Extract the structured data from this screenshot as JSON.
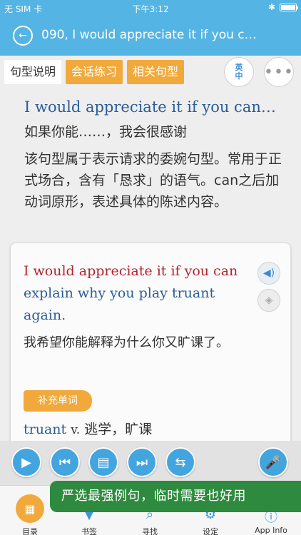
{
  "status": {
    "carrier": "无 SIM 卡",
    "time": "下午3:12"
  },
  "nav": {
    "title": "090, I would appreciate it if you c…"
  },
  "tabs": [
    {
      "label": "句型说明"
    },
    {
      "label": "会话练习"
    },
    {
      "label": "相关句型"
    }
  ],
  "lang_toggle": {
    "top": "英",
    "bottom": "中"
  },
  "pattern": {
    "english": "I would appreciate it if you can…",
    "chinese": "如果你能……，我会很感谢",
    "description": "该句型属于表示请求的委婉句型。常用于正式场合，含有「恳求」的语气。can之后加动词原形，表述具体的陈述内容。"
  },
  "example": {
    "highlight": "I would appreciate it if you can",
    "rest": "explain why you play truant again.",
    "chinese": "我希望你能解释为什么你又旷课了。"
  },
  "vocab": {
    "badge": "补充单词",
    "word": "truant",
    "pos": "v.",
    "meaning": "逃学，旷课"
  },
  "banner": {
    "text": "严选最强例句，临时需要也好用"
  },
  "tabbar": [
    {
      "label": "目录"
    },
    {
      "label": "书签"
    },
    {
      "label": "寻找"
    },
    {
      "label": "设定"
    },
    {
      "label": "App Info"
    }
  ],
  "colors": {
    "primary": "#54b4e4",
    "accent": "#f2a93b",
    "highlight": "#b3232f",
    "banner": "#2d8a3e"
  }
}
